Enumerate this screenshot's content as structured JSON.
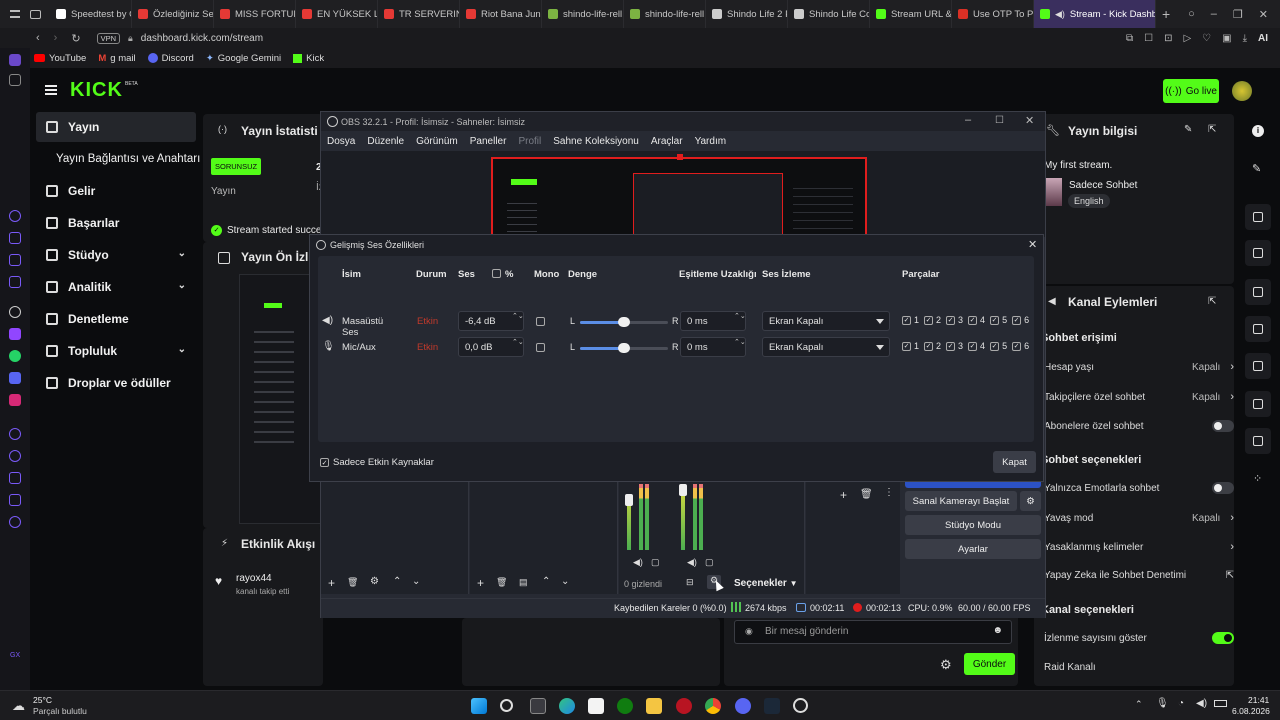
{
  "browser": {
    "tabs": [
      {
        "label": "Speedtest by O",
        "color": "#ffffff"
      },
      {
        "label": "Özlediğiniz Ser",
        "color": "#e53935"
      },
      {
        "label": "MISS FORTUN",
        "color": "#e53935"
      },
      {
        "label": "EN YÜKSEK LP",
        "color": "#e53935"
      },
      {
        "label": "TR SERVERIND",
        "color": "#e53935"
      },
      {
        "label": "Riot Bana Jung",
        "color": "#e53935"
      },
      {
        "label": "shindo-life-rell",
        "color": "#7cb342"
      },
      {
        "label": "shindo-life-rell",
        "color": "#7cb342"
      },
      {
        "label": "Shindo Life 2 P",
        "color": "#cccccc"
      },
      {
        "label": "Shindo Life Co",
        "color": "#cccccc"
      },
      {
        "label": "Stream URL &",
        "color": "#53fc18"
      },
      {
        "label": "Use OTP To Pi",
        "color": "#d93025"
      }
    ],
    "active_tab": "Stream - Kick Dashb",
    "url": "dashboard.kick.com/stream",
    "vpn": "VPN",
    "ai_label": "AI",
    "bookmarks": [
      "YouTube",
      "g mail",
      "Discord",
      "Google Gemini",
      "Kick"
    ]
  },
  "kick": {
    "logo": "KICK",
    "beta": "BETA",
    "go_live": "Go live",
    "nav": [
      {
        "label": "Yayın",
        "icon": "broadcast-icon"
      },
      {
        "label": "Yayın Bağlantısı ve Anahtarı",
        "icon": ""
      },
      {
        "label": "Gelir",
        "icon": "bar-chart-icon"
      },
      {
        "label": "Başarılar",
        "icon": "trophy-icon"
      },
      {
        "label": "Stüdyo",
        "icon": "studio-icon"
      },
      {
        "label": "Analitik",
        "icon": "analytics-icon"
      },
      {
        "label": "Denetleme",
        "icon": "wrench-icon"
      },
      {
        "label": "Topluluk",
        "icon": "community-icon"
      },
      {
        "label": "Droplar ve ödüller",
        "icon": "gift-icon"
      }
    ],
    "stats_title": "Yayın İstatisti",
    "status_badge": "SORUNSUZ",
    "stat_label": "Yayın",
    "stat_num": "2",
    "stat_small": "İz",
    "stream_started": "Stream started succe",
    "preview_title": "Yayın Ön İzl",
    "activity_title": "Etkinlik Akışı",
    "follower_name": "rayox44",
    "follower_action": "kanalı takip etti",
    "info_title": "Yayın bilgisi",
    "stream_title": "My first stream.",
    "category": "Sadece Sohbet",
    "language": "English",
    "channel_actions": "Kanal Eylemleri",
    "chat_access": "Sohbet erişimi",
    "rows": [
      {
        "label": "Hesap yaşı",
        "value": "Kapalı",
        "type": "arrow"
      },
      {
        "label": "Takipçilere özel sohbet",
        "value": "Kapalı",
        "type": "arrow"
      },
      {
        "label": "Abonelere özel sohbet",
        "value": "",
        "type": "toggle-off"
      }
    ],
    "chat_options": "Sohbet seçenekleri",
    "rows2": [
      {
        "label": "Yalnızca Emotlarla sohbet",
        "value": "",
        "type": "toggle-off"
      },
      {
        "label": "Yavaş mod",
        "value": "Kapalı",
        "type": "arrow"
      },
      {
        "label": "Yasaklanmış kelimeler",
        "value": "",
        "type": "arrow"
      },
      {
        "label": "Yapay Zeka ile Sohbet Denetimi",
        "value": "",
        "type": "external"
      }
    ],
    "channel_options": "Kanal seçenekleri",
    "rows3": [
      {
        "label": "İzlenme sayısını göster",
        "value": "",
        "type": "toggle-on"
      },
      {
        "label": "Raid Kanalı",
        "value": "",
        "type": "none"
      }
    ],
    "chat_placeholder": "Bir mesaj gönderin",
    "send": "Gönder"
  },
  "obs": {
    "title": "OBS 32.2.1 - Profil: İsimsiz - Sahneler: İsimsiz",
    "menu": [
      "Dosya",
      "Düzenle",
      "Görünüm",
      "Paneller",
      "Profil",
      "Sahne Koleksiyonu",
      "Araçlar",
      "Yardım"
    ],
    "hidden": "0 gizlendi",
    "options": "Seçenekler",
    "btn_virtual_cam": "Sanal Kamerayı Başlat",
    "btn_studio": "Stüdyo Modu",
    "btn_settings": "Ayarlar",
    "status": {
      "dropped": "Kaybedilen Kareler 0 (%0.0)",
      "kbps": "2674 kbps",
      "time1": "00:02:11",
      "time2": "00:02:13",
      "cpu": "CPU: 0.9%",
      "fps": "60.00 / 60.00 FPS"
    },
    "dialog": {
      "title": "Gelişmiş Ses Özellikleri",
      "headers": {
        "name": "İsim",
        "status": "Durum",
        "volume": "Ses",
        "percent": "%",
        "mono": "Mono",
        "balance": "Denge",
        "sync": "Eşitleme Uzaklığı",
        "monitor": "Ses İzleme",
        "tracks": "Parçalar"
      },
      "rows": [
        {
          "name": "Masaüstü Ses",
          "status": "Etkin",
          "volume": "-6,4 dB",
          "sync": "0 ms",
          "monitor": "Ekran Kapalı",
          "icon": "speaker-icon"
        },
        {
          "name": "Mic/Aux",
          "status": "Etkin",
          "volume": "0,0 dB",
          "sync": "0 ms",
          "monitor": "Ekran Kapalı",
          "icon": "microphone-icon"
        }
      ],
      "balance_l": "L",
      "balance_r": "R",
      "track_nums": [
        "1",
        "2",
        "3",
        "4",
        "5",
        "6"
      ],
      "active_only": "Sadece Etkin Kaynaklar",
      "close": "Kapat"
    }
  },
  "taskbar": {
    "temp": "25°C",
    "weather": "Parçalı bulutlu",
    "time": "21:41",
    "date": "6.08.2026"
  }
}
